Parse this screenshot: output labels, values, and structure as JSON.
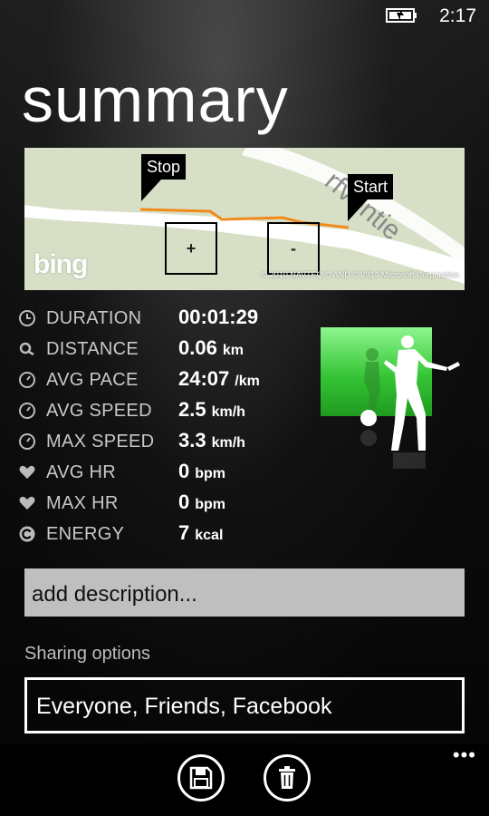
{
  "status_bar": {
    "time": "2:17",
    "battery_icon": "battery-charging-icon"
  },
  "page": {
    "title": "summary"
  },
  "map": {
    "pin_stop": "Stop",
    "pin_start": "Start",
    "zoom_in": "+",
    "zoom_out": "-",
    "street_label": "rfventie",
    "bing_logo": "bing",
    "copyright": "© 2010 NAVTEQ  © AND  © 2014 Microsoft Corporation",
    "route_color": "#f08a1c"
  },
  "stats": [
    {
      "icon": "clock-icon",
      "label": "DURATION",
      "value": "00:01:29",
      "unit": ""
    },
    {
      "icon": "distance-icon",
      "label": "DISTANCE",
      "value": "0.06",
      "unit": "km"
    },
    {
      "icon": "speedometer-icon",
      "label": "AVG PACE",
      "value": "24:07",
      "unit": "/km"
    },
    {
      "icon": "speedometer-icon",
      "label": "AVG SPEED",
      "value": "2.5",
      "unit": "km/h"
    },
    {
      "icon": "speedometer-icon",
      "label": "MAX SPEED",
      "value": "3.3",
      "unit": "km/h"
    },
    {
      "icon": "heart-icon",
      "label": "AVG HR",
      "value": "0",
      "unit": "bpm"
    },
    {
      "icon": "heart-icon",
      "label": "MAX HR",
      "value": "0",
      "unit": "bpm"
    },
    {
      "icon": "energy-icon",
      "label": "ENERGY",
      "value": "7",
      "unit": "kcal"
    }
  ],
  "sport": {
    "icon": "golf-icon",
    "color": "#35c535"
  },
  "description": {
    "placeholder": "add description..."
  },
  "sharing": {
    "label": "Sharing options",
    "value": "Everyone, Friends, Facebook"
  },
  "app_bar": {
    "save_icon": "save-icon",
    "delete_icon": "trash-icon",
    "more": "•••"
  }
}
